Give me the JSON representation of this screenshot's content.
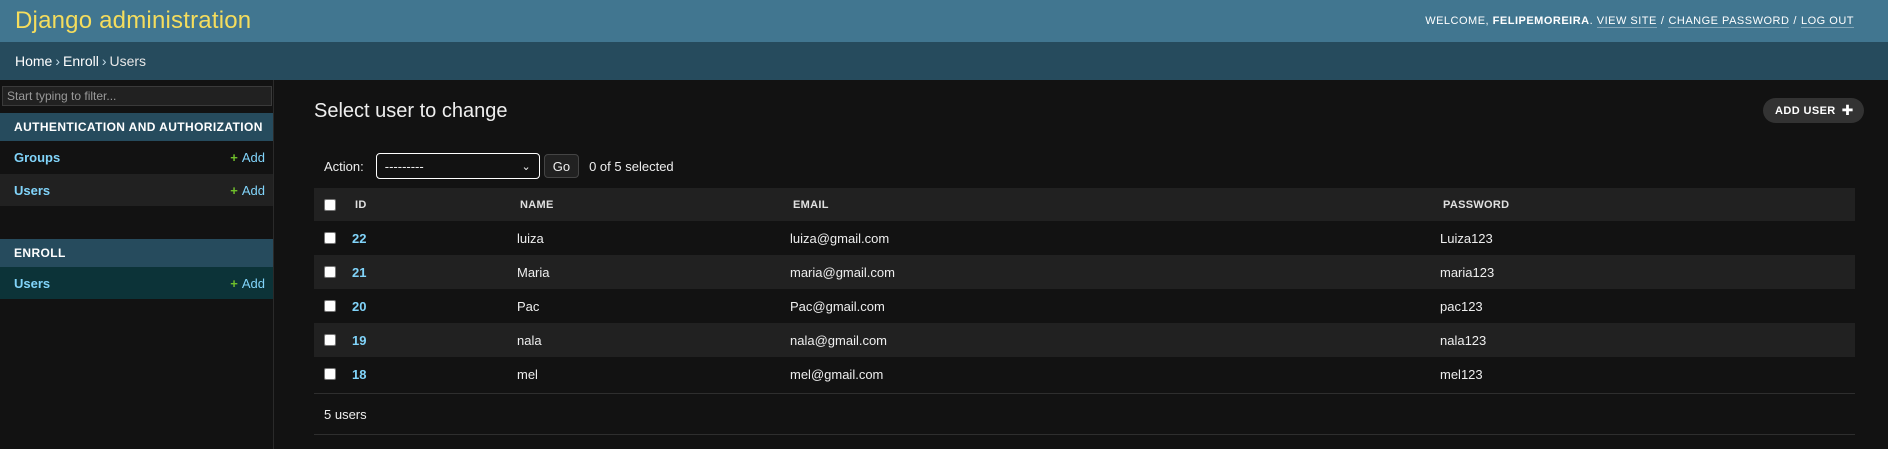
{
  "header": {
    "site_title": "Django administration",
    "welcome": "WELCOME,",
    "username": "FELIPEMOREIRA",
    "view_site": "VIEW SITE",
    "change_password": "CHANGE PASSWORD",
    "log_out": "LOG OUT"
  },
  "breadcrumbs": {
    "home": "Home",
    "app": "Enroll",
    "current": "Users",
    "separator": "›"
  },
  "sidebar": {
    "filter_placeholder": "Start typing to filter...",
    "apps": [
      {
        "caption": "AUTHENTICATION AND AUTHORIZATION",
        "models": [
          {
            "name": "Groups",
            "add": "Add"
          },
          {
            "name": "Users",
            "add": "Add"
          }
        ]
      },
      {
        "caption": "ENROLL",
        "models": [
          {
            "name": "Users",
            "add": "Add"
          }
        ]
      }
    ]
  },
  "content": {
    "title": "Select user to change",
    "add_button": "ADD USER",
    "action_label": "Action:",
    "action_selected": "---------",
    "go_label": "Go",
    "selection_count": "0 of 5 selected",
    "columns": [
      "ID",
      "NAME",
      "EMAIL",
      "PASSWORD"
    ],
    "rows": [
      {
        "id": "22",
        "name": "luiza",
        "email": "luiza@gmail.com",
        "password": "Luiza123"
      },
      {
        "id": "21",
        "name": "Maria",
        "email": "maria@gmail.com",
        "password": "maria123"
      },
      {
        "id": "20",
        "name": "Pac",
        "email": "Pac@gmail.com",
        "password": "pac123"
      },
      {
        "id": "19",
        "name": "nala",
        "email": "nala@gmail.com",
        "password": "nala123"
      },
      {
        "id": "18",
        "name": "mel",
        "email": "mel@gmail.com",
        "password": "mel123"
      }
    ],
    "result_count": "5 users"
  },
  "colors": {
    "header_bg": "#417690",
    "site_title": "#f5dd5d",
    "breadcrumbs_bg": "#264b5d",
    "link": "#81d4fa",
    "add_plus": "#70bf2b",
    "page_bg": "#121212"
  }
}
